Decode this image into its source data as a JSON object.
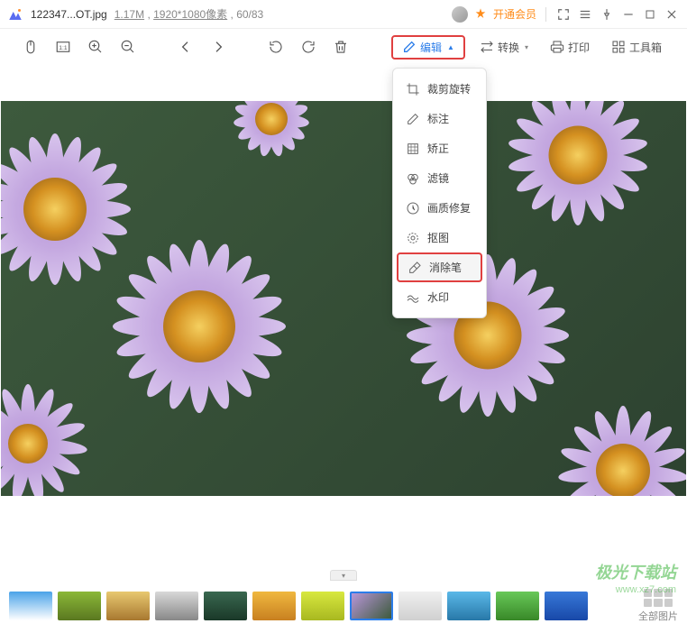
{
  "titlebar": {
    "filename": "122347...OT.jpg",
    "filesize": "1.17M",
    "dimensions": "1920*1080像素",
    "position": "60/83",
    "vip_label": "开通会员"
  },
  "toolbar": {
    "edit": "编辑",
    "convert": "转换",
    "print": "打印",
    "toolbox": "工具箱"
  },
  "dropdown": {
    "items": [
      {
        "label": "裁剪旋转"
      },
      {
        "label": "标注"
      },
      {
        "label": "矫正"
      },
      {
        "label": "滤镜"
      },
      {
        "label": "画质修复"
      },
      {
        "label": "抠图"
      },
      {
        "label": "消除笔"
      },
      {
        "label": "水印"
      }
    ]
  },
  "thumbnails": {
    "all_label": "全部图片"
  },
  "watermark": {
    "brand": "极光下载站",
    "url": "www.xz7.com"
  }
}
